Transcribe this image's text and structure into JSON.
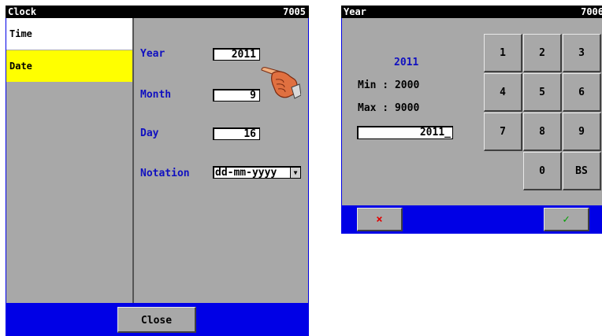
{
  "clock_window": {
    "title": "Clock",
    "id_code": "7005",
    "sidebar": [
      {
        "label": "Time"
      },
      {
        "label": "Date"
      }
    ],
    "fields": {
      "year_label": "Year",
      "year_value": "2011",
      "month_label": "Month",
      "month_value": "9",
      "day_label": "Day",
      "day_value": "16",
      "notation_label": "Notation",
      "notation_value": "dd-mm-yyyy"
    },
    "close_label": "Close",
    "icons": {
      "pointer": "hand-pointer-icon",
      "dropdown": "chevron-down-icon"
    }
  },
  "year_window": {
    "title": "Year",
    "id_code": "7006",
    "current_value": "2011",
    "min_text": "Min : 2000",
    "max_text": "Max : 9000",
    "entry_value": "2011_",
    "keys": [
      "1",
      "2",
      "3",
      "4",
      "5",
      "6",
      "7",
      "8",
      "9",
      "0",
      "BS"
    ],
    "cancel_icon": "×",
    "ok_icon": "✓"
  },
  "colors": {
    "frame_blue": "#0000e6",
    "panel_gray": "#a8a8a8",
    "title_black": "#000000",
    "selected_yellow": "#ffff00",
    "label_blue": "#1010c0",
    "cancel_red": "#e00000",
    "ok_green": "#00a000"
  }
}
